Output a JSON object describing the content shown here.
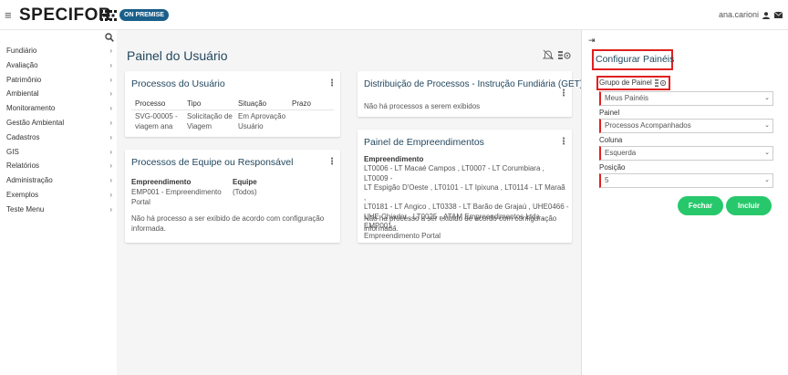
{
  "header": {
    "logo_text": "SPECIFOR",
    "badge": "ON PREMISE",
    "user_name": "ana.carioni"
  },
  "sidebar": {
    "items": [
      {
        "label": "Fundiário"
      },
      {
        "label": "Avaliação"
      },
      {
        "label": "Patrimônio"
      },
      {
        "label": "Ambiental"
      },
      {
        "label": "Monitoramento"
      },
      {
        "label": "Gestão Ambiental"
      },
      {
        "label": "Cadastros"
      },
      {
        "label": "GIS"
      },
      {
        "label": "Relatórios"
      },
      {
        "label": "Administração"
      },
      {
        "label": "Exemplos"
      },
      {
        "label": "Teste Menu"
      }
    ]
  },
  "main": {
    "title": "Painel do Usuário",
    "processos_usuario": {
      "title": "Processos do Usuário",
      "headers": [
        "Processo",
        "Tipo",
        "Situação",
        "Prazo"
      ],
      "row": {
        "processo_1": "SVG-00005 -",
        "processo_2": "viagem ana",
        "tipo_1": "Solicitação de",
        "tipo_2": "Viagem",
        "situacao_1": "Em Aprovação",
        "situacao_2": "Usuário",
        "prazo": ""
      }
    },
    "processos_equipe": {
      "title": "Processos de Equipe ou Responsável",
      "header_emp": "Empreendimento",
      "header_equipe": "Equipe",
      "emp_1": "EMP001 - Empreendimento",
      "emp_2": "Portal",
      "equipe": "(Todos)",
      "message_1": "Não há processo a ser exibido de acordo com configuração",
      "message_2": "informada."
    },
    "distribuicao": {
      "title": "Distribuição de Processos - Instrução Fundiária (GET)",
      "message": "Não há processos a serem exibidos"
    },
    "empreendimentos": {
      "title": "Painel de Empreendimentos",
      "header": "Empreendimento",
      "lines": [
        "LT0006 - LT Macaé Campos , LT0007 - LT Corumbiara , LT0009 -",
        "LT Espigão D'Oeste , LT0101 - LT Ipixuna , LT0114 - LT Maraã ,",
        "LT0181 - LT Angico , LT0338 - LT Barão de Grajaú , UHE0466 -",
        "UHE Chiador , LT0025 - ATAM Empreendimentos Ltda , EMP001 -",
        "Empreendimento Portal"
      ],
      "message_1": "Não há processo a ser exibido de acordo com configuração",
      "message_2": "informada."
    }
  },
  "config_panel": {
    "title": "Configurar Painéis",
    "grupo_label": "Grupo de Painel",
    "grupo_value": "Meus Painéis",
    "painel_label": "Painel",
    "painel_value": "Processos Acompanhados",
    "coluna_label": "Coluna",
    "coluna_value": "Esquerda",
    "posicao_label": "Posição",
    "posicao_value": "5",
    "fechar_label": "Fechar",
    "incluir_label": "Incluir"
  },
  "colors": {
    "title": "#23485f",
    "badge": "#1a5f8a",
    "button": "#27c86b",
    "highlight": "#e02020"
  }
}
